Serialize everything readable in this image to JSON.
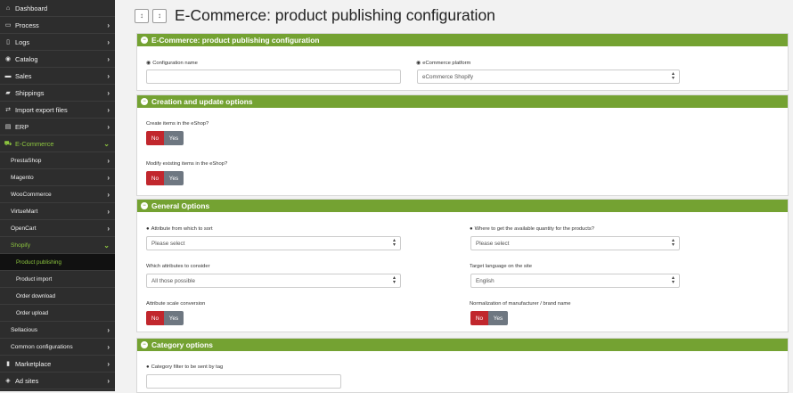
{
  "sidebar": {
    "items": [
      {
        "label": "Dashboard",
        "icon": "home-icon"
      },
      {
        "label": "Process",
        "icon": "process-icon"
      },
      {
        "label": "Logs",
        "icon": "logs-icon"
      },
      {
        "label": "Catalog",
        "icon": "catalog-icon"
      },
      {
        "label": "Sales",
        "icon": "sales-icon"
      },
      {
        "label": "Shippings",
        "icon": "truck-icon"
      },
      {
        "label": "Import export files",
        "icon": "import-export-icon"
      },
      {
        "label": "ERP",
        "icon": "erp-icon"
      },
      {
        "label": "E-Commerce",
        "icon": "cart-icon"
      },
      {
        "label": "PrestaShop"
      },
      {
        "label": "Magento"
      },
      {
        "label": "WooCommerce"
      },
      {
        "label": "VirtueMart"
      },
      {
        "label": "OpenCart"
      },
      {
        "label": "Shopify"
      },
      {
        "label": "Product publishing"
      },
      {
        "label": "Product import"
      },
      {
        "label": "Order download"
      },
      {
        "label": "Order upload"
      },
      {
        "label": "Sellacious"
      },
      {
        "label": "Common configurations"
      },
      {
        "label": "Marketplace",
        "icon": "marketplace-icon"
      },
      {
        "label": "Ad sites",
        "icon": "ad-sites-icon"
      }
    ]
  },
  "header": {
    "title": "E-Commerce: product publishing configuration",
    "btn1": "↕",
    "btn2": "↕"
  },
  "panels": {
    "config": {
      "title": "E-Commerce: product publishing configuration",
      "name_label": "Configuration name",
      "name_value": "",
      "platform_label": "eCommerce platform",
      "platform_value": "eCommerce Shopify"
    },
    "creation": {
      "title": "Creation and update options",
      "create_label": "Create items in the eShop?",
      "modify_label": "Modify existing items in the eShop?",
      "no": "No",
      "yes": "Yes"
    },
    "general": {
      "title": "General Options",
      "sort_label": "Attribute from which to sort",
      "sort_value": "Please select",
      "qty_label": "Where to get the available quantity for the products?",
      "qty_value": "Please select",
      "attrs_label": "Which attributes to consider",
      "attrs_value": "All those possible",
      "lang_label": "Target language on the site",
      "lang_value": "English",
      "scale_label": "Attribute scale conversion",
      "norm_label": "Normalization of manufacturer / brand name",
      "no": "No",
      "yes": "Yes"
    },
    "category": {
      "title": "Category options",
      "filter_label": "Category filter to be sent by tag",
      "filter_value": ""
    }
  },
  "colors": {
    "accent_green": "#74a232",
    "sidebar_green": "#8dc63f",
    "no_red": "#c1272d",
    "yes_gray": "#6e7781",
    "sidebar_bg": "#2d2d2d"
  }
}
